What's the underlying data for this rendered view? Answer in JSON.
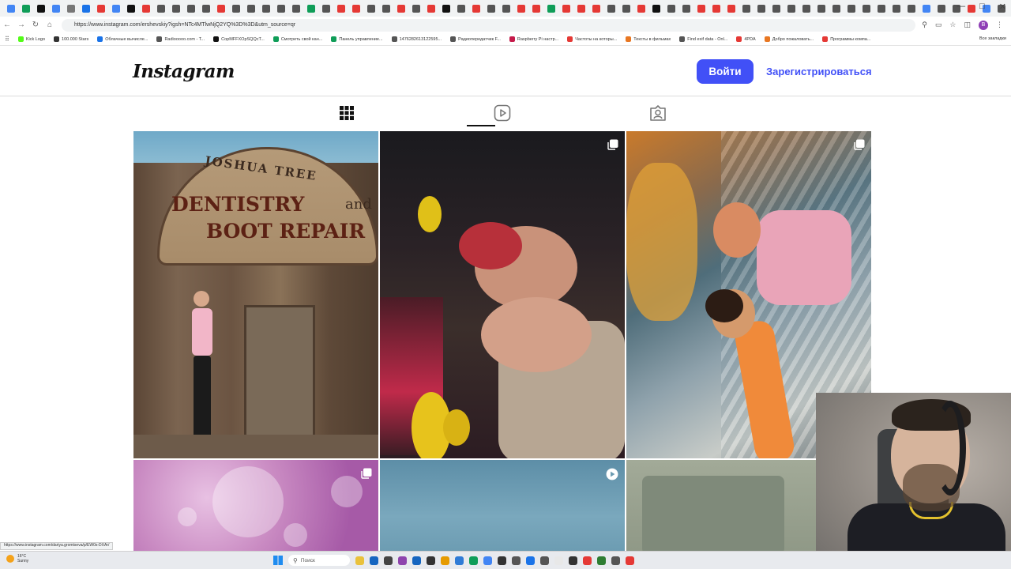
{
  "browser": {
    "url": "https://www.instagram.com/ershevskiy?igsh=NTc4MTlwNjQ2YQ%3D%3D&utm_source=qr",
    "tab_colors": [
      "#4285f4",
      "#0f9d58",
      "#111",
      "#4285f4",
      "#777",
      "#1a73e8",
      "#e53935",
      "#4285f4",
      "#111",
      "#e53935",
      "#555",
      "#555",
      "#555",
      "#555",
      "#e53935",
      "#555",
      "#555",
      "#555",
      "#555",
      "#555",
      "#0f9d58",
      "#555",
      "#e53935",
      "#e53935",
      "#555",
      "#555",
      "#e53935",
      "#555",
      "#e53935",
      "#111",
      "#555",
      "#e53935",
      "#555",
      "#555",
      "#e53935",
      "#e53935",
      "#0f9d58",
      "#e53935",
      "#e53935",
      "#e53935",
      "#555",
      "#555",
      "#e53935",
      "#111",
      "#555",
      "#555",
      "#e53935",
      "#e53935",
      "#e53935",
      "#555",
      "#555",
      "#555",
      "#555",
      "#555",
      "#555",
      "#555",
      "#555",
      "#555",
      "#555",
      "#555",
      "#555",
      "#4285f4",
      "#555",
      "#555",
      "#e53935",
      "#4285f4",
      "#555",
      "#555",
      "#555",
      "#555",
      "#555",
      "#555",
      "#555",
      "#555",
      "#555",
      "#f4b400"
    ],
    "profile_letter": "B",
    "bookmarks": [
      {
        "label": "Kick Logo",
        "color": "#53fc18"
      },
      {
        "label": "100.000 Stars",
        "color": "#333"
      },
      {
        "label": "Облачные вычисле...",
        "color": "#1a73e8"
      },
      {
        "label": "Radiooooo.com - T...",
        "color": "#555"
      },
      {
        "label": "CopMFFXOpSQQcT...",
        "color": "#111"
      },
      {
        "label": "Смотреть свой кан...",
        "color": "#0f9d58"
      },
      {
        "label": "Панель управление...",
        "color": "#0f9d58"
      },
      {
        "label": "1476282613122595...",
        "color": "#555"
      },
      {
        "label": "Радиопередатчик F...",
        "color": "#555"
      },
      {
        "label": "Raspberry Pi настр...",
        "color": "#c51a4a"
      },
      {
        "label": "Частоты на которы...",
        "color": "#e53935"
      },
      {
        "label": "Тексты в фильмах",
        "color": "#e87722"
      },
      {
        "label": "Find exif data - Onl...",
        "color": "#555"
      },
      {
        "label": "4PDA",
        "color": "#e53935"
      },
      {
        "label": "Добро пожаловать...",
        "color": "#e87722"
      },
      {
        "label": "Программы компа...",
        "color": "#e53935"
      }
    ],
    "bookmarks_right": "Все закладки"
  },
  "instagram": {
    "logo": "Instagram",
    "login_button": "Войти",
    "signup_link": "Зарегистрироваться",
    "brand_color": "#4150f7",
    "tabs": [
      {
        "icon": "grid-icon",
        "selected": true
      },
      {
        "icon": "reels-icon",
        "selected": false
      },
      {
        "icon": "tagged-icon",
        "selected": false
      }
    ],
    "photo1": {
      "line1": "JOSHUA TREE",
      "line2": "DENTISTRY",
      "line3": "and",
      "line4": "BOOT REPAIR"
    },
    "posts": [
      {
        "badge": "none"
      },
      {
        "badge": "carousel-icon"
      },
      {
        "badge": "carousel-icon"
      },
      {
        "badge": "carousel-icon"
      },
      {
        "badge": "reel-icon"
      },
      {
        "badge": "none"
      }
    ]
  },
  "status_link": "https://www.instagram.com/dariya.gromtseva/p/EW0s-DXAr/",
  "taskbar": {
    "weather_temp": "16°C",
    "weather_desc": "Sunny",
    "search_placeholder": "Поиск",
    "apps": [
      "#e9c13b",
      "#1565c0",
      "#444",
      "#8e44ad",
      "#1565c0",
      "#333",
      "#e69b00",
      "#2f7bd6",
      "#0f9d58",
      "#4285f4",
      "#333",
      "#555",
      "#1a73e8",
      "#555",
      "#e8e8e8",
      "#333",
      "#e53935",
      "#2e7d32",
      "#555",
      "#e53935"
    ]
  },
  "webcam": {
    "present": true
  }
}
